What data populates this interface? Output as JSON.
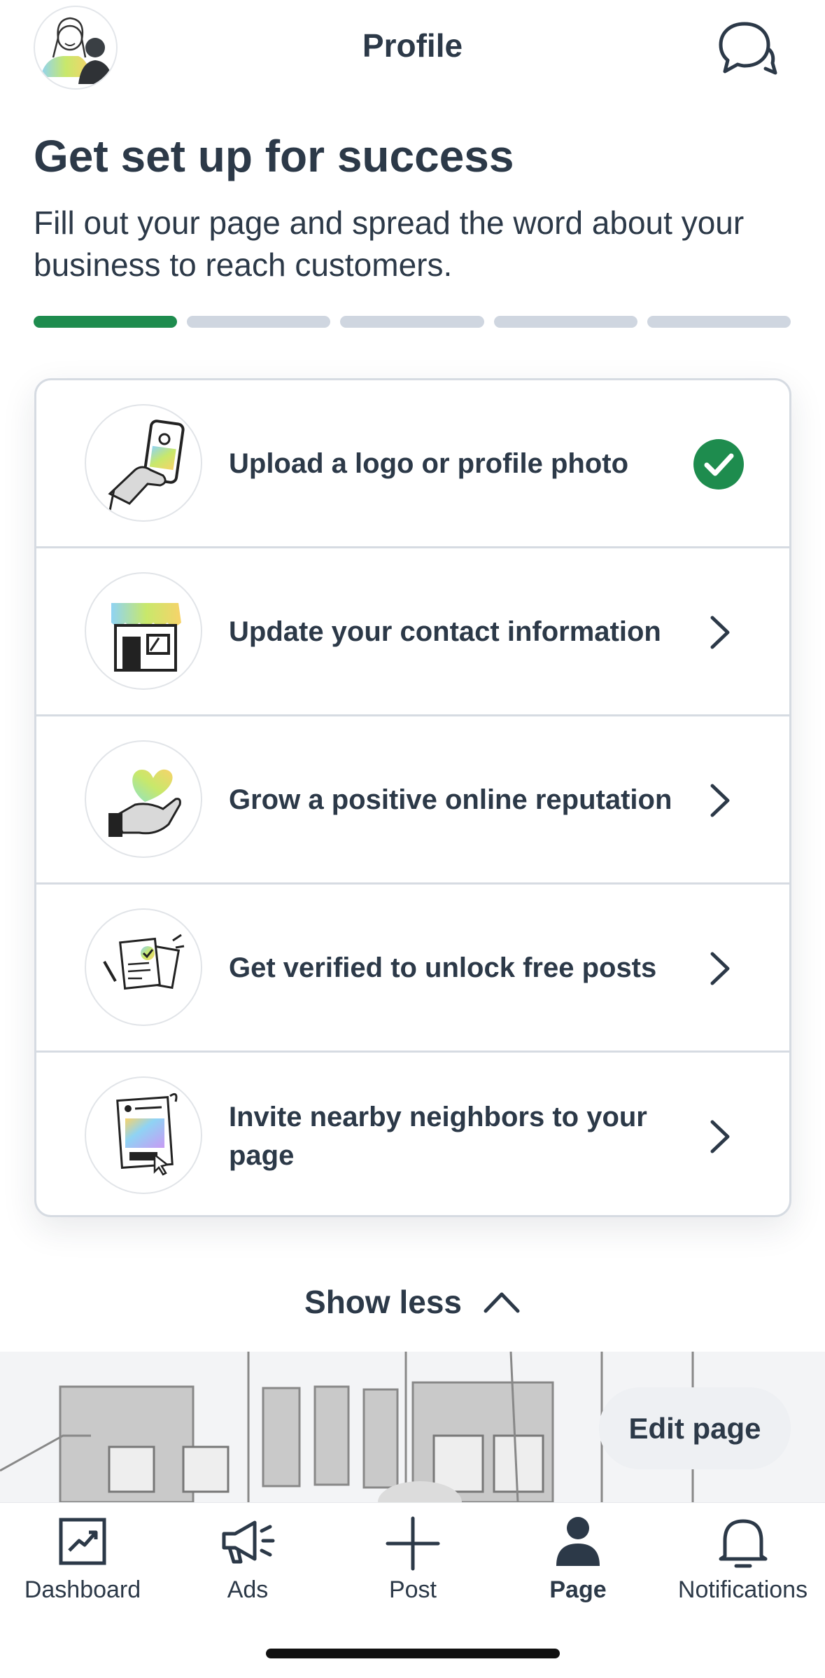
{
  "header": {
    "title": "Profile",
    "avatar_icon": "avatar-illustration-icon",
    "chat_icon": "chat-bubbles-icon"
  },
  "hero": {
    "title": "Get set up for success",
    "subtitle": "Fill out your page and spread the word about your business to reach customers."
  },
  "progress": {
    "total_steps": 5,
    "completed_steps": 1,
    "complete_color": "#1e8c4e",
    "incomplete_color": "#cfd6e0"
  },
  "tasks": [
    {
      "label": "Upload a logo or profile photo",
      "status": "complete",
      "icon": "hand-phone-photo-icon"
    },
    {
      "label": "Update your contact information",
      "status": "incomplete",
      "icon": "storefront-icon"
    },
    {
      "label": "Grow a positive online reputation",
      "status": "incomplete",
      "icon": "hand-heart-icon"
    },
    {
      "label": "Get verified to unlock free posts",
      "status": "incomplete",
      "icon": "documents-checkmark-icon"
    },
    {
      "label": "Invite nearby neighbors to your page",
      "status": "incomplete",
      "icon": "flyer-cursor-icon"
    }
  ],
  "show_less_label": "Show less",
  "edit_page_label": "Edit page",
  "tabbar": {
    "items": [
      {
        "label": "Dashboard",
        "icon": "chart-trend-icon",
        "active": false
      },
      {
        "label": "Ads",
        "icon": "megaphone-icon",
        "active": false
      },
      {
        "label": "Post",
        "icon": "plus-icon",
        "active": false
      },
      {
        "label": "Page",
        "icon": "person-icon",
        "active": true
      },
      {
        "label": "Notifications",
        "icon": "bell-icon",
        "active": false
      }
    ]
  },
  "colors": {
    "text": "#2c3948",
    "success": "#1e8c4e",
    "border": "#d6dbe2"
  }
}
